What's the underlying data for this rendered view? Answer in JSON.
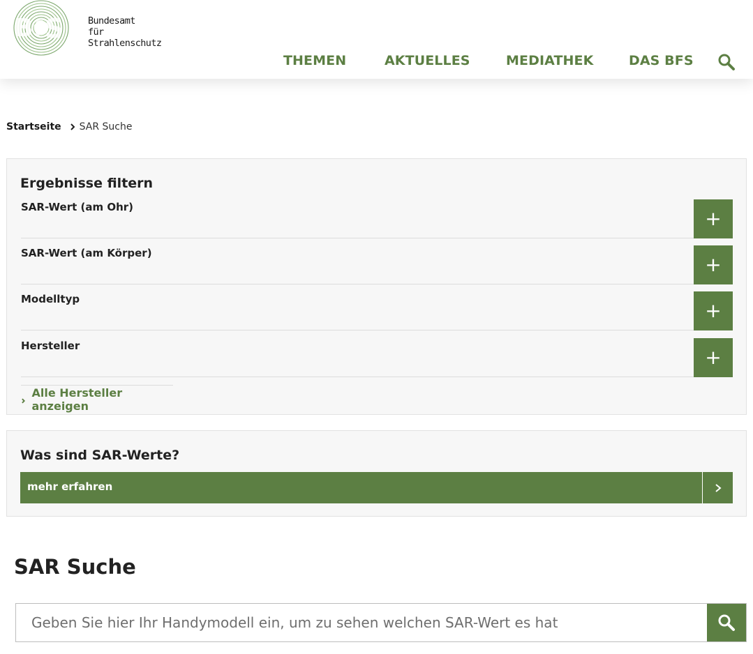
{
  "header": {
    "logo_line1": "Bundesamt",
    "logo_line2": "für Strahlenschutz",
    "logo_icon": "bfs-logo-icon",
    "nav": [
      {
        "label": "THEMEN"
      },
      {
        "label": "AKTUELLES"
      },
      {
        "label": "MEDIATHEK"
      },
      {
        "label": "DAS BFS"
      }
    ],
    "search_icon": "search-icon"
  },
  "breadcrumb": {
    "home": "Startseite",
    "current": "SAR Suche"
  },
  "filter": {
    "title": "Ergebnisse filtern",
    "items": [
      {
        "label": "SAR-Wert (am Ohr)",
        "toggle": "+"
      },
      {
        "label": "SAR-Wert (am Körper)",
        "toggle": "+"
      },
      {
        "label": "Modelltyp",
        "toggle": "+"
      },
      {
        "label": "Hersteller",
        "toggle": "+"
      }
    ],
    "all_manufacturers": "Alle Hersteller anzeigen"
  },
  "info": {
    "title": "Was sind SAR-Werte?",
    "more": "mehr erfahren"
  },
  "search": {
    "title": "SAR Suche",
    "placeholder": "Geben Sie hier Ihr Handymodell ein, um zu sehen welchen SAR-Wert es hat",
    "value": ""
  },
  "colors": {
    "accent": "#5c7f43",
    "panel_bg": "#f7f7f7"
  }
}
